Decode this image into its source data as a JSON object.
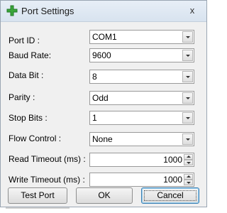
{
  "window": {
    "title": "Port Settings",
    "close_label": "x"
  },
  "fields": {
    "port_id": {
      "label": "Port ID :",
      "value": "COM1"
    },
    "baud_rate": {
      "label": "Baud Rate:",
      "value": "9600"
    },
    "data_bit": {
      "label": "Data Bit :",
      "value": "8"
    },
    "parity": {
      "label": "Parity :",
      "value": "Odd"
    },
    "stop_bits": {
      "label": "Stop Bits :",
      "value": "1"
    },
    "flow_control": {
      "label": "Flow Control :",
      "value": "None"
    },
    "read_timeout": {
      "label": "Read Timeout (ms) :",
      "value": "1000"
    },
    "write_timeout": {
      "label": "Write Timeout (ms) :",
      "value": "1000"
    }
  },
  "buttons": {
    "test_port": "Test Port",
    "ok": "OK",
    "cancel": "Cancel"
  },
  "colors": {
    "title_bar": "#dfe8f3",
    "dialog_bg": "#f0f0f0",
    "accent_icon": "#3aa63a",
    "default_button_border": "#3c7fb1"
  },
  "icons": {
    "app_icon": "green-plus-icon"
  }
}
